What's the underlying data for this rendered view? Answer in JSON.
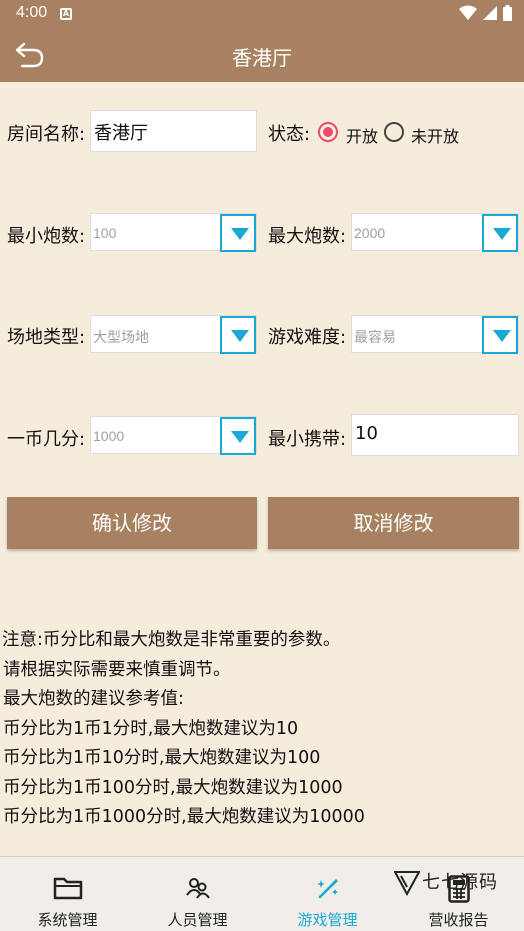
{
  "status_bar": {
    "time": "4:00",
    "notification_glyph": "A"
  },
  "app_bar": {
    "title": "香港厅"
  },
  "form": {
    "room_name_label": "房间名称:",
    "room_name_value": "香港厅",
    "status_label": "状态:",
    "status_options": [
      {
        "label": "开放",
        "selected": true
      },
      {
        "label": "未开放",
        "selected": false
      }
    ],
    "min_cannon_label": "最小炮数:",
    "min_cannon_value": "100",
    "max_cannon_label": "最大炮数:",
    "max_cannon_value": "2000",
    "venue_type_label": "场地类型:",
    "venue_type_value": "大型场地",
    "difficulty_label": "游戏难度:",
    "difficulty_value": "最容易",
    "coin_ratio_label": "一币几分:",
    "coin_ratio_value": "1000",
    "min_carry_label": "最小携带:",
    "min_carry_value": "10"
  },
  "buttons": {
    "confirm": "确认修改",
    "cancel": "取消修改"
  },
  "notes": [
    "注意:币分比和最大炮数是非常重要的参数。",
    " 请根据实际需要来慎重调节。",
    " 最大炮数的建议参考值:",
    " 币分比为1币1分时,最大炮数建议为10",
    " 币分比为1币10分时,最大炮数建议为100",
    " 币分比为1币100分时,最大炮数建议为1000",
    " 币分比为1币1000分时,最大炮数建议为10000"
  ],
  "bottom_nav": [
    {
      "label": "系统管理",
      "icon": "folder-icon",
      "active": false
    },
    {
      "label": "人员管理",
      "icon": "people-icon",
      "active": false
    },
    {
      "label": "游戏管理",
      "icon": "magic-wand-icon",
      "active": true
    },
    {
      "label": "营收报告",
      "icon": "calculator-icon",
      "active": false
    }
  ],
  "watermark": {
    "text": "七七源码"
  },
  "colors": {
    "primary": "#a88260",
    "background": "#f6ecdc",
    "accent": "#1aa8d6",
    "radio": "#e84c6a"
  }
}
